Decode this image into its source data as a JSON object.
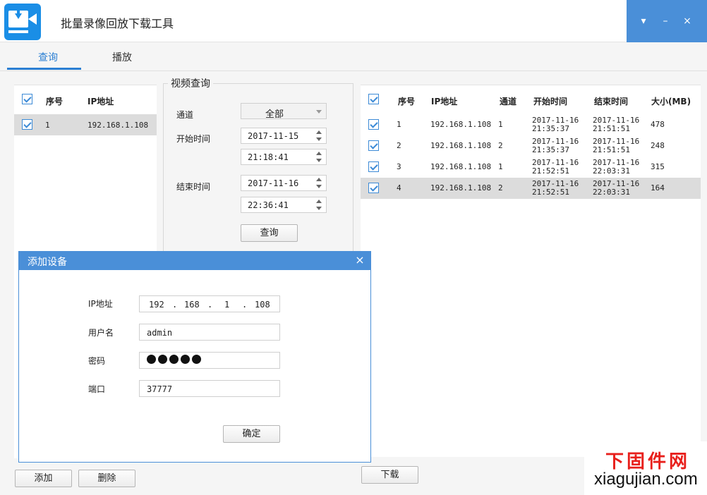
{
  "app": {
    "title": "批量录像回放下载工具",
    "window_controls": {
      "menu": "▾",
      "minimize": "–",
      "close": "×"
    }
  },
  "tabs": [
    {
      "label": "查询",
      "active": true
    },
    {
      "label": "播放",
      "active": false
    }
  ],
  "device_list": {
    "headers": {
      "index": "序号",
      "ip": "IP地址"
    },
    "rows": [
      {
        "index": "1",
        "ip": "192.168.1.108",
        "checked": true,
        "selected": true
      }
    ]
  },
  "query": {
    "group_title": "视频查询",
    "channel_label": "通道",
    "channel_value": "全部",
    "start_label": "开始时间",
    "start_date": "2017-11-15",
    "start_time": "21:18:41",
    "end_label": "结束时间",
    "end_date": "2017-11-16",
    "end_time": "22:36:41",
    "query_button": "查询"
  },
  "results": {
    "headers": {
      "index": "序号",
      "ip": "IP地址",
      "channel": "通道",
      "start": "开始时间",
      "end": "结束时间",
      "size": "大小(MB)"
    },
    "rows": [
      {
        "index": "1",
        "ip": "192.168.1.108",
        "channel": "1",
        "start_date": "2017-11-16",
        "start_time": "21:35:37",
        "end_date": "2017-11-16",
        "end_time": "21:51:51",
        "size": "478"
      },
      {
        "index": "2",
        "ip": "192.168.1.108",
        "channel": "2",
        "start_date": "2017-11-16",
        "start_time": "21:35:37",
        "end_date": "2017-11-16",
        "end_time": "21:51:51",
        "size": "248"
      },
      {
        "index": "3",
        "ip": "192.168.1.108",
        "channel": "1",
        "start_date": "2017-11-16",
        "start_time": "21:52:51",
        "end_date": "2017-11-16",
        "end_time": "22:03:31",
        "size": "315"
      },
      {
        "index": "4",
        "ip": "192.168.1.108",
        "channel": "2",
        "start_date": "2017-11-16",
        "start_time": "21:52:51",
        "end_date": "2017-11-16",
        "end_time": "22:03:31",
        "size": "164"
      }
    ]
  },
  "dialog": {
    "title": "添加设备",
    "close": "×",
    "ip_label": "IP地址",
    "ip_octets": [
      "192",
      "168",
      "1",
      "108"
    ],
    "ip_dot": ".",
    "username_label": "用户名",
    "username_value": "admin",
    "password_label": "密码",
    "password_length": 5,
    "port_label": "端口",
    "port_value": "37777",
    "confirm_button": "确定"
  },
  "bottom": {
    "add_button": "添加",
    "delete_button": "删除",
    "download_button": "下载"
  },
  "watermark": {
    "line1": "下固件网",
    "line2": "xiagujian.com"
  },
  "colors": {
    "accent": "#4a8fd8",
    "tab_active": "#2b7fd3",
    "watermark_red": "#e8201c"
  }
}
